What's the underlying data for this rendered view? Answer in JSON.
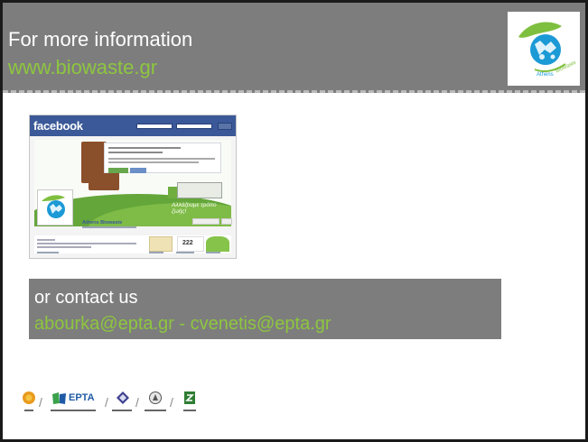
{
  "header": {
    "title": "For more information",
    "link": "www.biowaste.gr",
    "logo_text": "Athens Biowaste",
    "bg_color": "#7d7d7d",
    "link_color": "#8ec63f"
  },
  "facebook": {
    "brand": "facebook",
    "page_name": "Athens Biowaste",
    "cover_slogan": "Αλλάζουμε τρόπο ζωής!",
    "likes": "222",
    "like_button_icon": "thumbs-up-icon"
  },
  "contact": {
    "title": "or contact us",
    "emails": "abourka@epta.gr - cvenetis@epta.gr"
  },
  "partners": {
    "epta_label": "EPTA",
    "separator": "/",
    "icons": [
      "sun-emblem-icon",
      "epta-logo-icon",
      "diamond-emblem-icon",
      "municipality-emblem-icon",
      "recycling-emblem-icon"
    ]
  }
}
